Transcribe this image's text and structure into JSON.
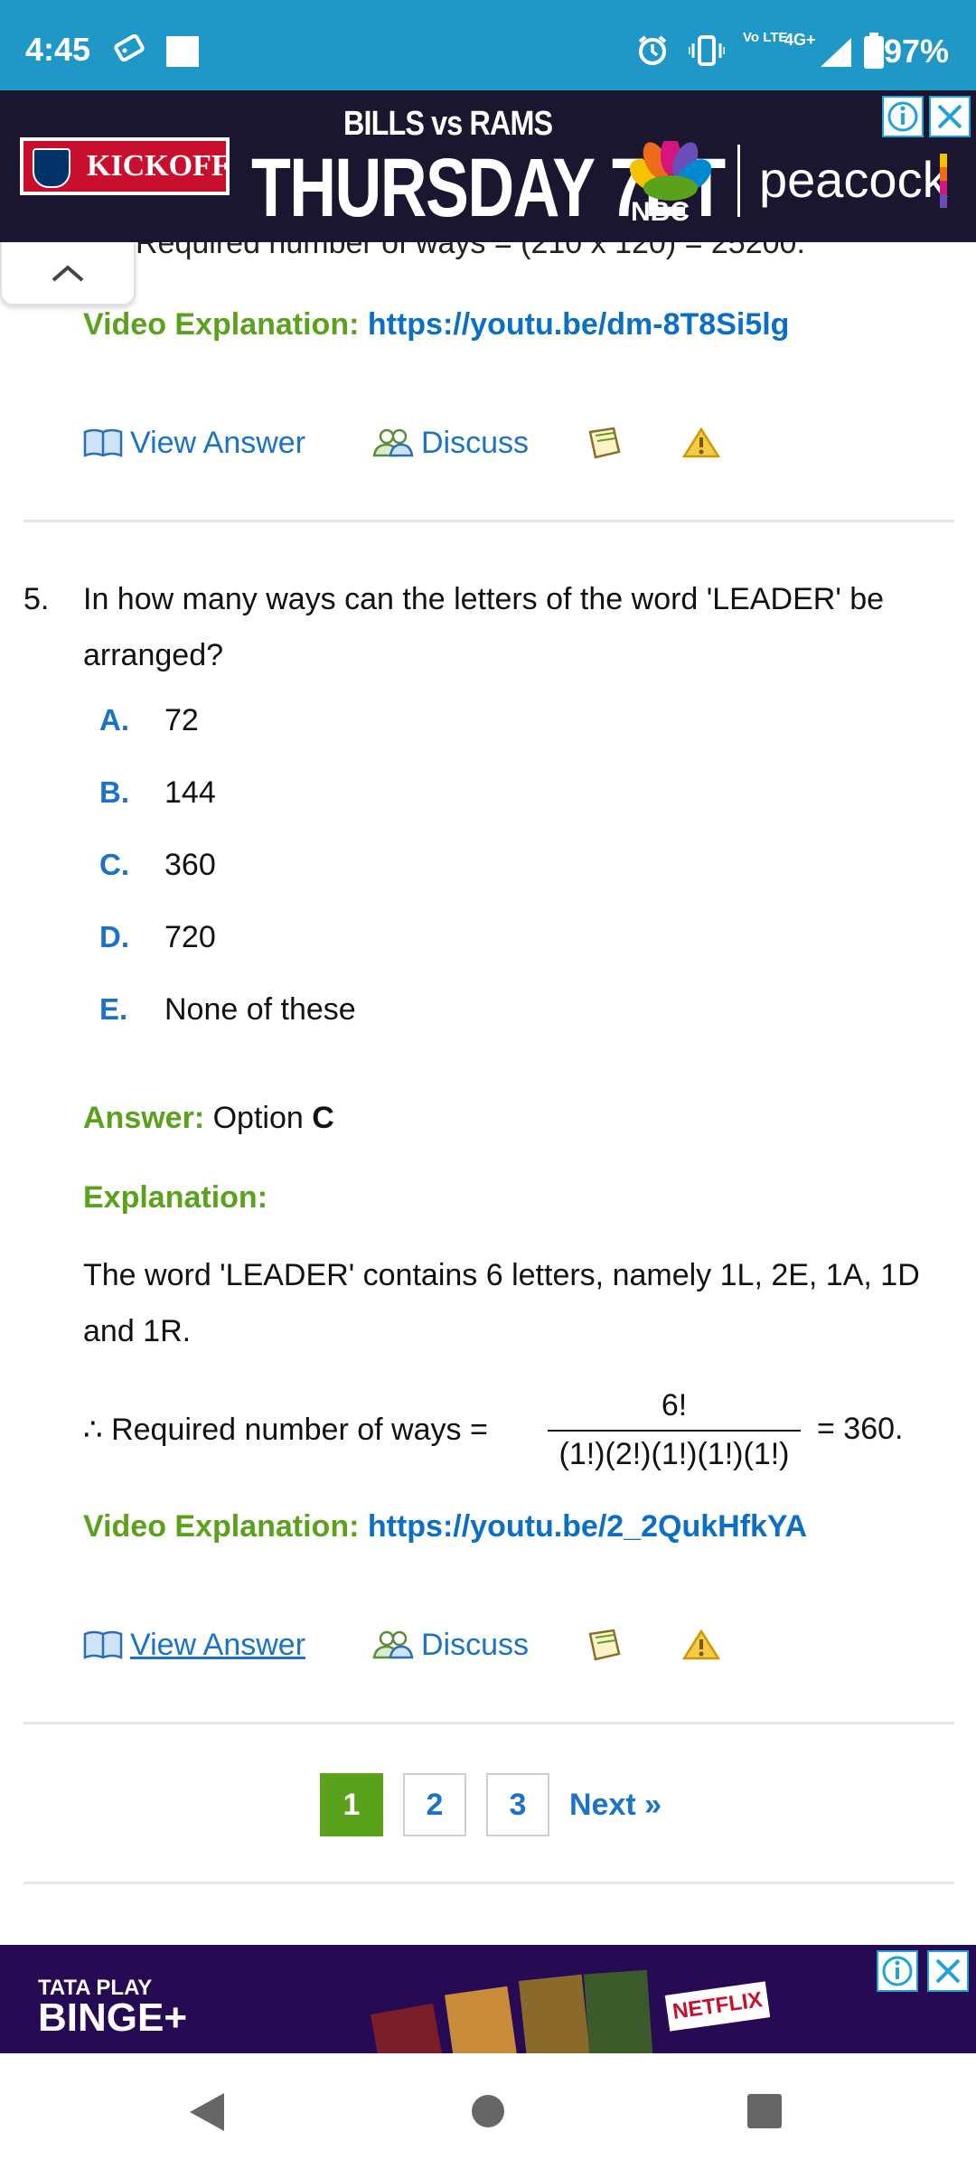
{
  "status_bar": {
    "time": "4:45",
    "battery": "97%",
    "network": "4G+",
    "volte": "Vo LTE"
  },
  "ad_top": {
    "badge": "KICKOFF",
    "matchup": "BILLS vs RAMS",
    "headline": "THURSDAY 7ET",
    "network": "NBC",
    "brand": "peacock"
  },
  "content": {
    "partial_line": "Required number of ways = (210 x 120) = 25200.",
    "prev_video_label": "Video Explanation:",
    "prev_video_url": "https://youtu.be/dm-8T8Si5lg",
    "tools": {
      "view_answer": "View Answer",
      "discuss": "Discuss"
    },
    "question": {
      "number": "5.",
      "text": "In how many ways can the letters of the word 'LEADER' be arranged?",
      "options": [
        {
          "letter": "A.",
          "text": "72"
        },
        {
          "letter": "B.",
          "text": "144"
        },
        {
          "letter": "C.",
          "text": "360"
        },
        {
          "letter": "D.",
          "text": "720"
        },
        {
          "letter": "E.",
          "text": "None of these"
        }
      ],
      "answer_label": "Answer:",
      "answer_prefix": "Option",
      "answer_value": "C",
      "explanation_label": "Explanation:",
      "explanation_text": "The word 'LEADER' contains 6 letters, namely 1L, 2E, 1A, 1D and 1R.",
      "formula_prefix": "∴  Required number of ways =",
      "formula_numerator": "6!",
      "formula_denominator": "(1!)(2!)(1!)(1!)(1!)",
      "formula_result": "= 360.",
      "video_label": "Video Explanation:",
      "video_url": "https://youtu.be/2_2QukHfkYA"
    },
    "pagination": {
      "pages": [
        "1",
        "2",
        "3"
      ],
      "active": "1",
      "next": "Next »"
    }
  },
  "ad_bottom": {
    "brand_top": "TATA PLAY",
    "brand_bottom": "BINGE+",
    "partner": "NETFLIX"
  },
  "colors": {
    "status_bar": "#1f98c8",
    "green": "#5aa11c",
    "link_blue": "#0b6fc5",
    "accent_blue": "#1a73c8"
  }
}
